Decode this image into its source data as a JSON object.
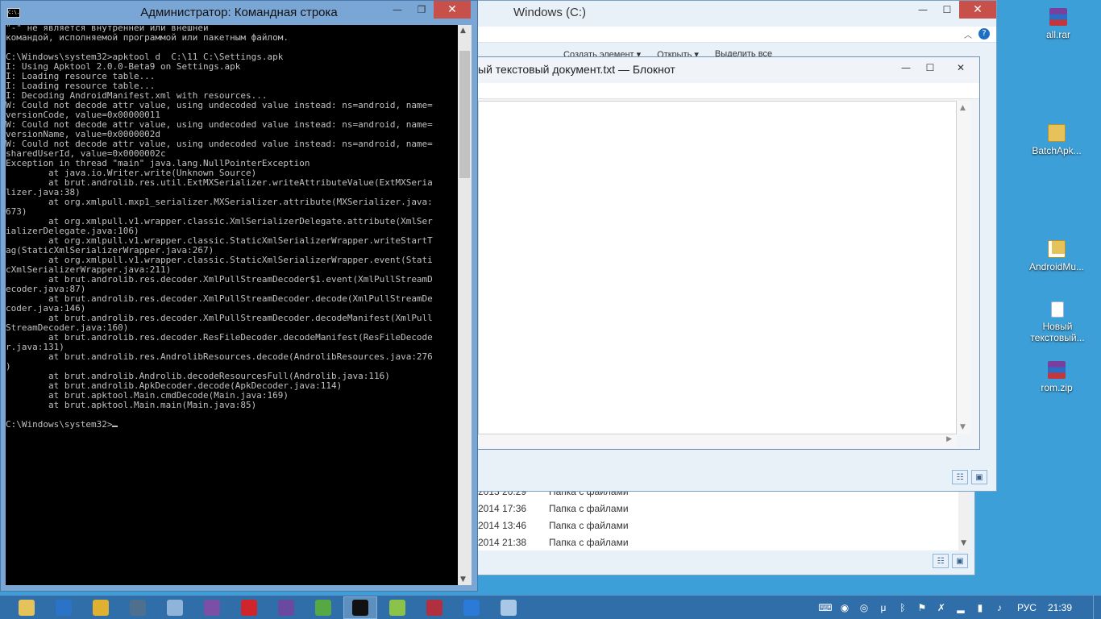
{
  "explorer": {
    "title": "Windows (C:)",
    "ribbon_cmds": [
      "Создать элемент ▾",
      "Открыть ▾",
      "Выделить все"
    ],
    "rows": [
      {
        "date": "2013 20:29",
        "type": "Папка с файлами"
      },
      {
        "date": "2014 17:36",
        "type": "Папка с файлами"
      },
      {
        "date": "2014 13:46",
        "type": "Папка с файлами"
      },
      {
        "date": "2014 21:38",
        "type": "Папка с файлами"
      }
    ]
  },
  "notepad": {
    "title": "ый текстовый документ.txt — Блокнот",
    "content": ""
  },
  "console": {
    "title": "Администратор: Командная строка",
    "app_icon_label": "C:\\.",
    "lines": [
      "\"-\" не является внутренней или внешней",
      "командой, исполняемой программой или пакетным файлом.",
      "",
      "C:\\Windows\\system32>apktool d  C:\\11 C:\\Settings.apk",
      "I: Using Apktool 2.0.0-Beta9 on Settings.apk",
      "I: Loading resource table...",
      "I: Loading resource table...",
      "I: Decoding AndroidManifest.xml with resources...",
      "W: Could not decode attr value, using undecoded value instead: ns=android, name=",
      "versionCode, value=0x00000011",
      "W: Could not decode attr value, using undecoded value instead: ns=android, name=",
      "versionName, value=0x0000002d",
      "W: Could not decode attr value, using undecoded value instead: ns=android, name=",
      "sharedUserId, value=0x0000002c",
      "Exception in thread \"main\" java.lang.NullPointerException",
      "        at java.io.Writer.write(Unknown Source)",
      "        at brut.androlib.res.util.ExtMXSerializer.writeAttributeValue(ExtMXSeria",
      "lizer.java:38)",
      "        at org.xmlpull.mxp1_serializer.MXSerializer.attribute(MXSerializer.java:",
      "673)",
      "        at org.xmlpull.v1.wrapper.classic.XmlSerializerDelegate.attribute(XmlSer",
      "ializerDelegate.java:106)",
      "        at org.xmlpull.v1.wrapper.classic.StaticXmlSerializerWrapper.writeStartT",
      "ag(StaticXmlSerializerWrapper.java:267)",
      "        at org.xmlpull.v1.wrapper.classic.StaticXmlSerializerWrapper.event(Stati",
      "cXmlSerializerWrapper.java:211)",
      "        at brut.androlib.res.decoder.XmlPullStreamDecoder$1.event(XmlPullStreamD",
      "ecoder.java:87)",
      "        at brut.androlib.res.decoder.XmlPullStreamDecoder.decode(XmlPullStreamDe",
      "coder.java:146)",
      "        at brut.androlib.res.decoder.XmlPullStreamDecoder.decodeManifest(XmlPull",
      "StreamDecoder.java:160)",
      "        at brut.androlib.res.decoder.ResFileDecoder.decodeManifest(ResFileDecode",
      "r.java:131)",
      "        at brut.androlib.res.AndrolibResources.decode(AndrolibResources.java:276",
      ")",
      "        at brut.androlib.Androlib.decodeResourcesFull(Androlib.java:116)",
      "        at brut.androlib.ApkDecoder.decode(ApkDecoder.java:114)",
      "        at brut.apktool.Main.cmdDecode(Main.java:169)",
      "        at brut.apktool.Main.main(Main.java:85)",
      "",
      "C:\\Windows\\system32>"
    ]
  },
  "desktop_icons": [
    {
      "label": "all.rar",
      "icon": "rar-archive-icon"
    },
    {
      "label": "BatchApk...",
      "icon": "folder-icon"
    },
    {
      "label": "AndroidMu...",
      "icon": "folder-icon"
    },
    {
      "label": "Новый текстовый...",
      "icon": "text-file-icon"
    },
    {
      "label": "rom.zip",
      "icon": "rar-archive-icon"
    }
  ],
  "taskbar": {
    "items": [
      {
        "name": "file-explorer",
        "color": "#e3c35a"
      },
      {
        "name": "remote-desktop",
        "color": "#2b73c7"
      },
      {
        "name": "chrome",
        "color": "#e0b030"
      },
      {
        "name": "tool",
        "color": "#4f6f8f"
      },
      {
        "name": "calculator",
        "color": "#8fb4d9"
      },
      {
        "name": "visual-studio",
        "color": "#7b4fa6"
      },
      {
        "name": "opera",
        "color": "#d0252d"
      },
      {
        "name": "eclipse",
        "color": "#6a4aa0"
      },
      {
        "name": "globe",
        "color": "#56a844"
      },
      {
        "name": "cmd",
        "color": "#111111"
      },
      {
        "name": "android-tool",
        "color": "#8bc34a"
      },
      {
        "name": "winrar",
        "color": "#b03040"
      },
      {
        "name": "download",
        "color": "#2a7ad8"
      },
      {
        "name": "notepad",
        "color": "#a9c8e6"
      }
    ],
    "active_index": 9,
    "lang": "РУС",
    "time": "21:39"
  }
}
